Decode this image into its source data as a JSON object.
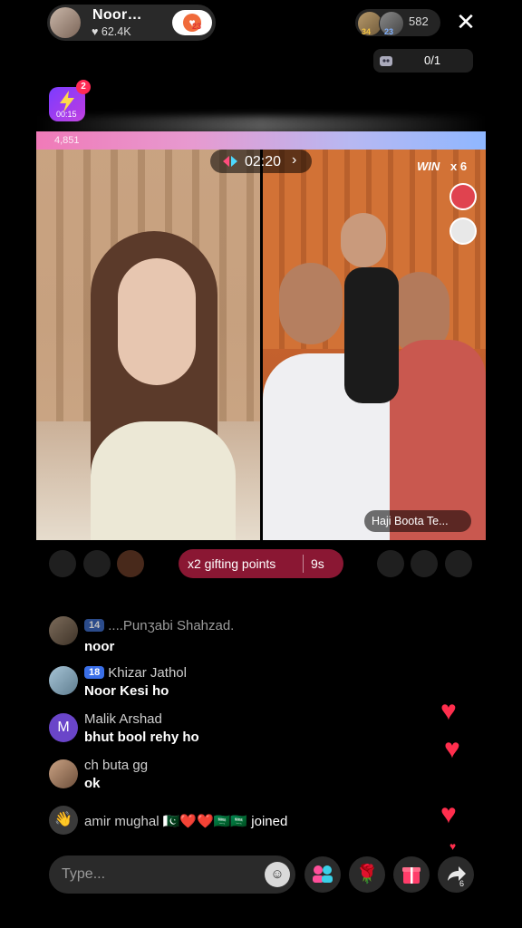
{
  "header": {
    "host_name": "Noor…",
    "host_likes": "62.4K",
    "follow_badge_count": "23",
    "viewer_badges": [
      "34",
      "23"
    ],
    "viewer_count": "582",
    "close_symbol": "✕",
    "counter": "0/1"
  },
  "battle": {
    "notification_count": "2",
    "battle_time_small": "00:15",
    "left_score": "4,851",
    "timer": "02:20",
    "win_label": "WIN",
    "win_count": "x 6",
    "right_host_name": "Haji Boota Te..."
  },
  "gifting": {
    "label": "x2 gifting points",
    "timer": "9s"
  },
  "comments": [
    {
      "name": "....Punʒabi  Shahzad.",
      "level": "14",
      "message": "noor"
    },
    {
      "name": "Khizar Jathol",
      "level": "18",
      "message": "Noor Kesi ho"
    },
    {
      "name": "Malik Arshad",
      "initial": "M",
      "message": "bhut bool rehy ho"
    },
    {
      "name": "ch buta gg",
      "message": "ok"
    }
  ],
  "join_event": {
    "name": "amir mughal",
    "emojis": "🇵🇰❤️❤️🇸🇦🇸🇦",
    "text": "joined"
  },
  "composer": {
    "placeholder": "Type...",
    "share_count": "6"
  },
  "colors": {
    "gift_pill": "#8a1733",
    "heart": "#ff2e4d",
    "left_bar": "#f07ab8",
    "right_bar": "#8fb7ff"
  },
  "icons": [
    "heart-icon",
    "close-icon",
    "battle-icon",
    "gear-icon",
    "emoji-icon",
    "people-icon",
    "rose-icon",
    "gift-icon",
    "share-icon"
  ]
}
